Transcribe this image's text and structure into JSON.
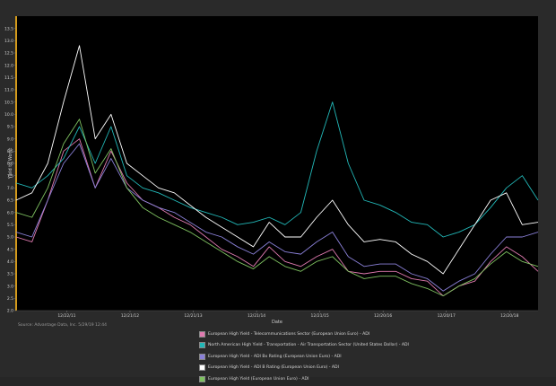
{
  "chart_data": {
    "type": "line",
    "title": "",
    "xlabel": "Date",
    "ylabel": "Yield to Worst",
    "ylim": [
      2.0,
      14.0
    ],
    "y_ticks": [
      2.0,
      2.5,
      3.0,
      3.5,
      4.0,
      4.5,
      5.0,
      5.5,
      6.0,
      6.5,
      7.0,
      7.5,
      8.0,
      8.5,
      9.0,
      9.5,
      10.0,
      10.5,
      11.0,
      11.5,
      12.0,
      12.5,
      13.0,
      13.5
    ],
    "x_ticks": [
      "12/22/11",
      "12/21/12",
      "12/21/13",
      "12/21/14",
      "12/21/15",
      "12/20/16",
      "12/20/17",
      "12/20/18"
    ],
    "x_tick_positions": [
      0.8,
      1.8,
      2.8,
      3.8,
      4.8,
      5.8,
      6.8,
      7.8
    ],
    "grid": false,
    "legend_position": "bottom",
    "source": "Source: Advantage Data, Inc. 5/29/19 12:44",
    "x": [
      0.0,
      0.25,
      0.5,
      0.75,
      1.0,
      1.25,
      1.5,
      1.75,
      2.0,
      2.25,
      2.5,
      2.75,
      3.0,
      3.25,
      3.5,
      3.75,
      4.0,
      4.25,
      4.5,
      4.75,
      5.0,
      5.25,
      5.5,
      5.75,
      6.0,
      6.25,
      6.5,
      6.75,
      7.0,
      7.25,
      7.5,
      7.75,
      8.0,
      8.25
    ],
    "series": [
      {
        "name": "European High Yield - Telecommunications Sector (European Union Euro) - ADI",
        "color": "#e07ab0",
        "values": [
          5.0,
          4.8,
          6.5,
          8.5,
          9.0,
          7.0,
          8.5,
          7.2,
          6.5,
          6.2,
          5.8,
          5.5,
          5.0,
          4.5,
          4.2,
          3.8,
          4.6,
          4.0,
          3.8,
          4.2,
          4.5,
          3.6,
          3.5,
          3.6,
          3.6,
          3.3,
          3.2,
          2.6,
          3.0,
          3.2,
          4.0,
          4.6,
          4.2,
          3.6
        ]
      },
      {
        "name": "North American High Yield - Transportation - Air Transportation Sector (United States Dollar) - ADI",
        "color": "#22b8b8",
        "values": [
          7.2,
          7.0,
          7.5,
          8.2,
          9.5,
          8.0,
          9.5,
          7.5,
          7.0,
          6.8,
          6.5,
          6.2,
          6.0,
          5.8,
          5.5,
          5.6,
          5.8,
          5.5,
          6.0,
          8.5,
          10.5,
          8.0,
          6.5,
          6.3,
          6.0,
          5.6,
          5.5,
          5.0,
          5.2,
          5.5,
          6.2,
          7.0,
          7.5,
          6.5
        ]
      },
      {
        "name": "European High Yield - ADI Bx Rating (European Union Euro) - ADI",
        "color": "#8a80d8",
        "values": [
          5.2,
          5.0,
          6.5,
          8.0,
          8.8,
          7.0,
          8.2,
          7.0,
          6.5,
          6.2,
          6.0,
          5.6,
          5.2,
          5.0,
          4.6,
          4.3,
          4.8,
          4.4,
          4.3,
          4.8,
          5.2,
          4.2,
          3.8,
          3.9,
          3.9,
          3.5,
          3.3,
          2.8,
          3.2,
          3.5,
          4.3,
          5.0,
          5.0,
          5.2
        ]
      },
      {
        "name": "European High Yield - ADI B Rating (European Union Euro) - ADI",
        "color": "#ffffff",
        "values": [
          6.5,
          6.8,
          8.0,
          10.5,
          12.8,
          9.0,
          10.0,
          8.0,
          7.5,
          7.0,
          6.8,
          6.3,
          5.8,
          5.4,
          5.0,
          4.6,
          5.6,
          5.0,
          5.0,
          5.8,
          6.5,
          5.5,
          4.8,
          4.9,
          4.8,
          4.3,
          4.0,
          3.5,
          4.5,
          5.5,
          6.5,
          6.8,
          5.5,
          5.6
        ]
      },
      {
        "name": "European High Yield (European Union Euro) - ADI",
        "color": "#7ec060",
        "values": [
          6.0,
          5.8,
          7.0,
          8.8,
          9.8,
          7.6,
          8.6,
          7.0,
          6.2,
          5.8,
          5.5,
          5.2,
          4.8,
          4.4,
          4.0,
          3.7,
          4.2,
          3.8,
          3.6,
          4.0,
          4.2,
          3.6,
          3.3,
          3.4,
          3.4,
          3.1,
          2.9,
          2.6,
          3.0,
          3.3,
          3.9,
          4.4,
          4.0,
          3.8
        ]
      }
    ]
  }
}
